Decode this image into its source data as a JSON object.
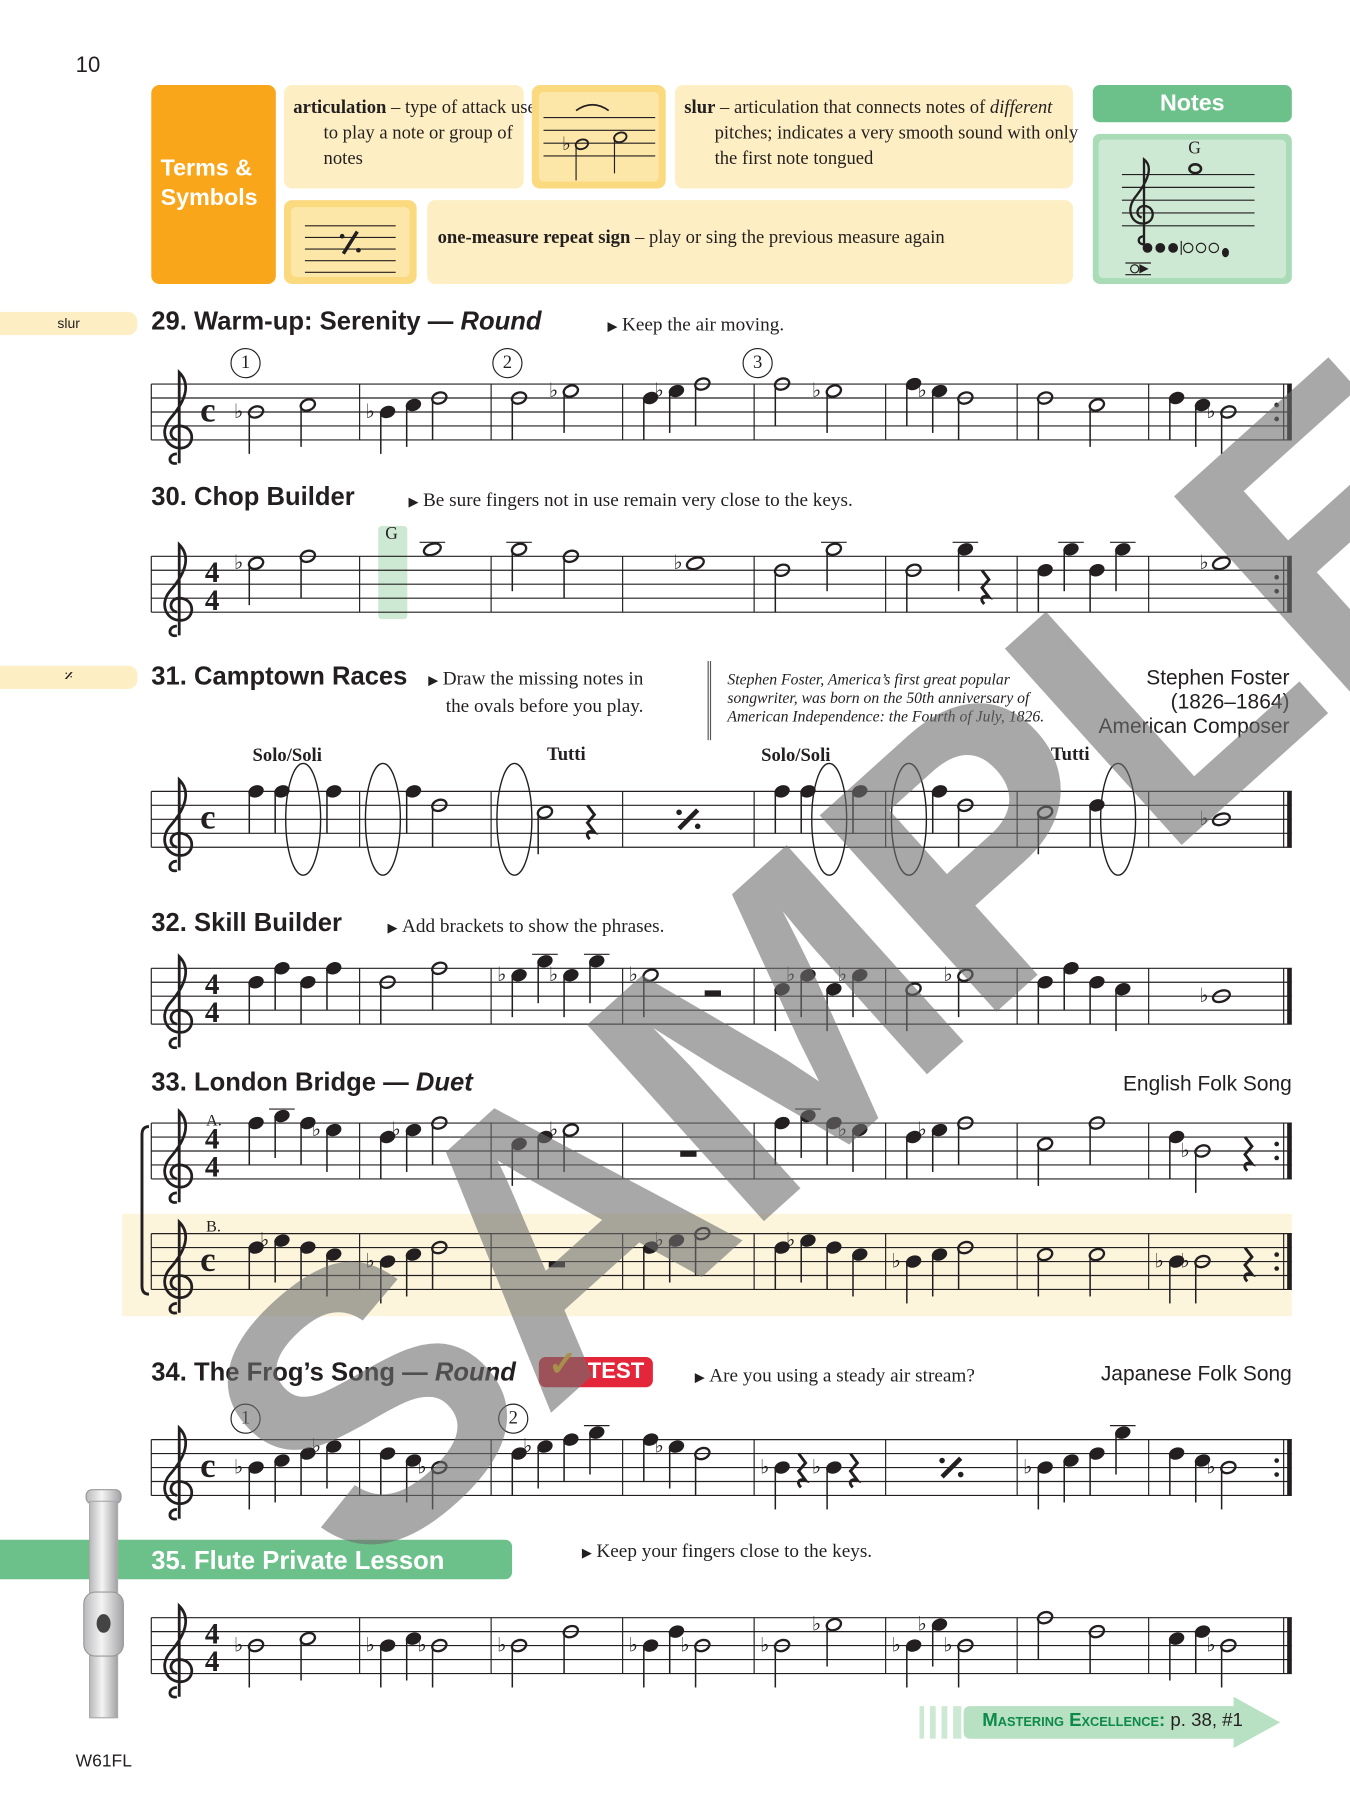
{
  "page_number": "10",
  "footer_code": "W61FL",
  "watermark": "SAMPLE",
  "terms": {
    "heading_line1": "Terms &",
    "heading_line2": "Symbols",
    "articulation_term": "articulation",
    "articulation_def": " – type of attack used to play a note or group of notes",
    "slur_term": "slur",
    "slur_def_1": " – articulation that connects notes of ",
    "slur_def_italic": "different",
    "slur_def_2": " pitches; indicates a very smooth sound with only the first note tongued",
    "repeat_term": "one-measure repeat sign",
    "repeat_def": " – play or sing the previous measure again",
    "notes_heading": "Notes",
    "notes_label": "G"
  },
  "margin_tabs": {
    "slur": "slur",
    "repeat": "𝄎"
  },
  "exercises": [
    {
      "title": "29. Warm-up: Serenity — ",
      "title_italic": "Round",
      "direction": "Keep the air moving.",
      "markers": [
        "1",
        "2",
        "3"
      ]
    },
    {
      "title": "30. Chop Builder",
      "direction": "Be sure fingers not in use remain very close to the keys.",
      "note_label": "G"
    },
    {
      "title": "31. Camptown Races",
      "direction_1": "Draw the missing notes in",
      "direction_2": "the ovals before you play.",
      "sidebar_note": "Stephen Foster, America’s first great popular songwriter, was born on the 50th anniversary of American Independence: the Fourth of July, 1826.",
      "composer_1": "Stephen Foster",
      "composer_2": "(1826–1864)",
      "composer_3": "American Composer",
      "labels": [
        "Solo/Soli",
        "Tutti",
        "Solo/Soli",
        "Tutti"
      ]
    },
    {
      "title": "32. Skill Builder",
      "direction": "Add brackets to show the phrases."
    },
    {
      "title": "33. London Bridge — ",
      "title_italic": "Duet",
      "credit": "English Folk Song",
      "part_a": "A.",
      "part_b": "B."
    },
    {
      "title": "34. The Frog’s Song — ",
      "title_italic": "Round",
      "badge": "TEST",
      "direction": "Are you using a steady air stream?",
      "credit": "Japanese Folk Song",
      "markers": [
        "1",
        "2"
      ]
    },
    {
      "title": "35. Flute Private Lesson",
      "direction": "Keep your fingers close to the keys."
    }
  ],
  "mastering": {
    "label": "Mastering Excellence:",
    "ref": " p. 38, #1"
  },
  "colors": {
    "orange": "#f9a61a",
    "cream": "#fdefc3",
    "green": "#6cc18b",
    "green_light": "#cde9d3",
    "test_red": "#e4263b",
    "highlight": "#fcf5dc"
  },
  "staves": [
    {
      "id": "29",
      "time": "C",
      "end": "repeat",
      "measures": [
        [
          "Bb4h",
          "C5h"
        ],
        [
          "Bb4q",
          "C5q",
          "D5h"
        ],
        [
          "D5h",
          "Eb5h"
        ],
        [
          "D5q",
          "Eb5q",
          "F5h"
        ],
        [
          "F5h",
          "Eb5h"
        ],
        [
          "F5q",
          "Eb5q",
          "D5h"
        ],
        [
          "D5h",
          "C5h"
        ],
        [
          "D5q",
          "C5q",
          "Bb4h"
        ]
      ]
    },
    {
      "id": "30",
      "time": "4/4",
      "end": "repeat",
      "measures": [
        [
          "Eb5h",
          "F5h"
        ],
        [
          "G5w"
        ],
        [
          "G5h",
          "F5h"
        ],
        [
          "Eb5w"
        ],
        [
          "D5h",
          "G5h"
        ],
        [
          "D5h",
          "G5q",
          "rq"
        ],
        [
          "D5q",
          "G5q",
          "D5q",
          "G5q"
        ],
        [
          "Eb5w"
        ]
      ]
    },
    {
      "id": "31",
      "time": "C",
      "end": "final",
      "measures": [
        [
          "F5q",
          "F5q",
          "oval",
          "F5q"
        ],
        [
          "oval",
          "F5q",
          "D5h"
        ],
        [
          "oval",
          "C5h",
          "rq"
        ],
        [
          "rpt"
        ],
        [
          "F5q",
          "F5q",
          "oval",
          "F5q"
        ],
        [
          "oval",
          "F5q",
          "D5h"
        ],
        [
          "C5h",
          "D5q",
          "oval"
        ],
        [
          "Bb4w"
        ]
      ]
    },
    {
      "id": "32",
      "time": "4/4",
      "end": "final",
      "measures": [
        [
          "D5q",
          "F5q",
          "D5q",
          "F5q"
        ],
        [
          "D5h",
          "F5h"
        ],
        [
          "Eb5q",
          "G5q",
          "Eb5q",
          "G5q"
        ],
        [
          "Eb5h",
          "rh"
        ],
        [
          "C5q",
          "Eb5q",
          "C5q",
          "Eb5q"
        ],
        [
          "C5h",
          "Eb5h"
        ],
        [
          "D5q",
          "F5q",
          "D5q",
          "C5q"
        ],
        [
          "Bb4w"
        ]
      ]
    },
    {
      "id": "33a",
      "time": "4/4",
      "end": "repeat",
      "measures": [
        [
          "F5q",
          "G5q",
          "F5q",
          "Eb5q"
        ],
        [
          "D5q",
          "Eb5q",
          "F5h"
        ],
        [
          "C5q",
          "D5q",
          "Eb5h"
        ],
        [
          "rw"
        ],
        [
          "F5q",
          "G5q",
          "F5q",
          "Eb5q"
        ],
        [
          "D5q",
          "Eb5q",
          "F5h"
        ],
        [
          "C5h",
          "F5h"
        ],
        [
          "D5q",
          "Bb4h",
          "rq"
        ]
      ]
    },
    {
      "id": "33b",
      "time": "C",
      "end": "repeat",
      "measures": [
        [
          "D5q",
          "Eb5q",
          "D5q",
          "C5q"
        ],
        [
          "Bb4q",
          "C5q",
          "D5h"
        ],
        [
          "rw"
        ],
        [
          "D5q",
          "Eb5q",
          "F5h"
        ],
        [
          "D5q",
          "Eb5q",
          "D5q",
          "C5q"
        ],
        [
          "Bb4q",
          "C5q",
          "D5h"
        ],
        [
          "C5h",
          "C5h"
        ],
        [
          "Bb4q",
          "Bb4h",
          "rq"
        ]
      ]
    },
    {
      "id": "34",
      "time": "C",
      "end": "repeat",
      "measures": [
        [
          "Bb4q",
          "C5q",
          "D5q",
          "Eb5q"
        ],
        [
          "D5q",
          "C5q",
          "Bb4h"
        ],
        [
          "D5q",
          "Eb5q",
          "F5q",
          "G5q"
        ],
        [
          "F5q",
          "Eb5q",
          "D5h"
        ],
        [
          "Bb4q",
          "rq",
          "Bb4q",
          "rq"
        ],
        [
          "rpt"
        ],
        [
          "Bb4q",
          "C5q",
          "D5q",
          "G5q"
        ],
        [
          "D5q",
          "C5q",
          "Bb4h"
        ]
      ]
    },
    {
      "id": "35",
      "time": "4/4",
      "end": "final",
      "measures": [
        [
          "Bb4h",
          "C5h"
        ],
        [
          "Bb4q",
          "C5q",
          "Bb4h"
        ],
        [
          "Bb4h",
          "D5h"
        ],
        [
          "Bb4q",
          "D5q",
          "Bb4h"
        ],
        [
          "Bb4h",
          "Eb5h"
        ],
        [
          "Bb4q",
          "Eb5q",
          "Bb4h"
        ],
        [
          "F5h",
          "D5h"
        ],
        [
          "C5q",
          "D5q",
          "Bb4h"
        ]
      ]
    }
  ]
}
